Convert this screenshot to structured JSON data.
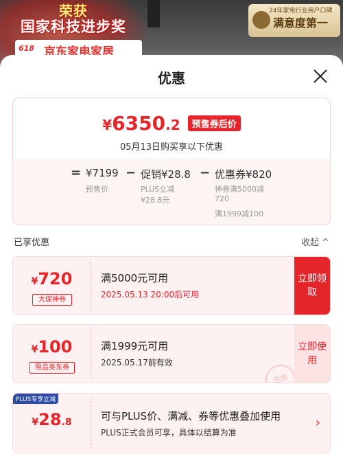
{
  "background": {
    "slogan_line1": "荣获",
    "slogan_line2": "国家科技进步奖",
    "store_tag": "618",
    "store_name": "京东家电家居",
    "award_small": "24年家电行业用户口碑",
    "award_big": "满意度第一"
  },
  "sheet": {
    "title": "优惠",
    "summary": {
      "price_yen": "¥",
      "price_int": "6350",
      "price_dec": ".2",
      "price_tag": "预售券后价",
      "date_line": "05月13日购买享以下优惠",
      "calc": {
        "eq": "=",
        "base_value": "¥7199",
        "base_label": "预售价",
        "minus1": "−",
        "promo_value": "促销¥28.8",
        "promo_sub1": "PLUS立减",
        "promo_sub2": "¥28.8元",
        "minus2": "−",
        "coupon_value": "优惠券¥820",
        "coupon_sub1": "神券满5000减",
        "coupon_sub2": "720",
        "coupon_sub3": "满1999减100"
      }
    },
    "section": {
      "left": "已享优惠",
      "right": "收起 ^"
    },
    "coupons": [
      {
        "amount_yen": "¥",
        "amount": "720",
        "badge": "大促神券",
        "condition": "满5000元可用",
        "time": "2025.05.13 20:00后可用",
        "time_color": "#e4262b",
        "action": "立即领取"
      },
      {
        "amount_yen": "¥",
        "amount": "100",
        "badge": "限品类东券",
        "condition": "满1999元可用",
        "time": "2025.05.17前有效",
        "time_color": "#333333",
        "action": "立即使用",
        "stamp": "已领"
      }
    ],
    "plus": {
      "tag": "PLUS专享立减",
      "amount_yen": "¥",
      "amount": "28",
      "amount_dec": ".8",
      "text1": "可与PLUS价、满减、券等优惠叠加使用",
      "text2": "PLUS正式会员可享，具体以结算为准"
    }
  },
  "colors": {
    "accent": "#e4262b",
    "coupon_bg": "#fdf1f1",
    "plus_tag": "#2c4aa6"
  }
}
